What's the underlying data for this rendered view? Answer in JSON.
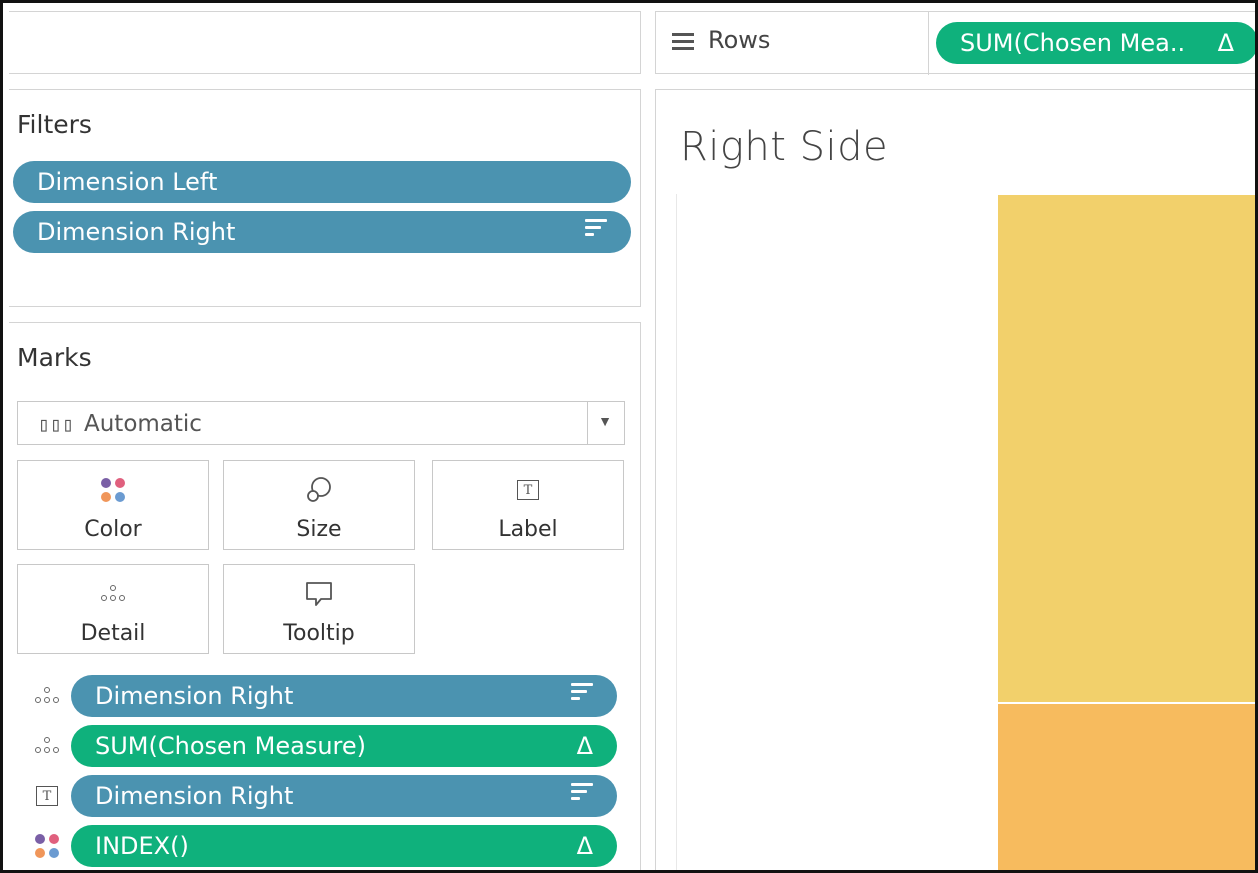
{
  "rows_shelf": {
    "label": "Rows",
    "pill": {
      "text": "SUM(Chosen Mea..",
      "icon": "Δ"
    }
  },
  "filters": {
    "title": "Filters",
    "pills": [
      {
        "text": "Dimension Left",
        "color": "#4b93b0",
        "icon": ""
      },
      {
        "text": "Dimension Right",
        "color": "#4b93b0",
        "icon": "sort-icon"
      }
    ]
  },
  "marks": {
    "title": "Marks",
    "mark_type": {
      "icon": "bar-chart-icon",
      "label": "Automatic"
    },
    "buttons": [
      {
        "label": "Color",
        "icon": "color-icon"
      },
      {
        "label": "Size",
        "icon": "size-icon"
      },
      {
        "label": "Label",
        "icon": "label-icon"
      },
      {
        "label": "Detail",
        "icon": "detail-icon"
      },
      {
        "label": "Tooltip",
        "icon": "tooltip-icon"
      }
    ],
    "cards": [
      {
        "role_icon": "detail-icon",
        "text": "Dimension Right",
        "color": "#4b93b0",
        "icon": "sort-icon"
      },
      {
        "role_icon": "detail-icon",
        "text": "SUM(Chosen Measure)",
        "color": "#0fb17c",
        "icon": "Δ"
      },
      {
        "role_icon": "label-icon",
        "text": "Dimension Right",
        "color": "#4b93b0",
        "icon": "sort-icon"
      },
      {
        "role_icon": "color-icon",
        "text": "INDEX()",
        "color": "#0fb17c",
        "icon": "Δ"
      }
    ]
  },
  "view": {
    "title": "Right Side",
    "segment_colors": [
      "#f2d06b",
      "#f7bb5e"
    ]
  },
  "colors": {
    "dimension_pill": "#4b93b0",
    "measure_pill": "#0fb17c"
  }
}
